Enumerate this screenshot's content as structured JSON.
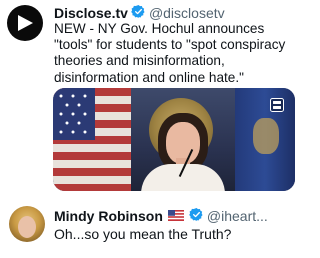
{
  "post": {
    "author_name": "Disclose.tv",
    "author_handle": "@disclosetv",
    "text": "NEW - NY Gov. Hochul announces \"tools\" for students to \"spot conspiracy theories and misinformation, disinformation and online hate.\"",
    "avatar_icon": "play-triangle-icon",
    "verified_icon": "verified-badge-icon",
    "media_icon": "gif-badge-icon"
  },
  "reply": {
    "author_name": "Mindy Robinson",
    "author_handle": "@iheart...",
    "flag_icon": "us-flag-icon",
    "verified_icon": "verified-badge-icon",
    "text": "Oh...so you mean the Truth?"
  },
  "colors": {
    "text": "#0f1419",
    "secondary": "#536471",
    "verified": "#1d9bf0"
  }
}
